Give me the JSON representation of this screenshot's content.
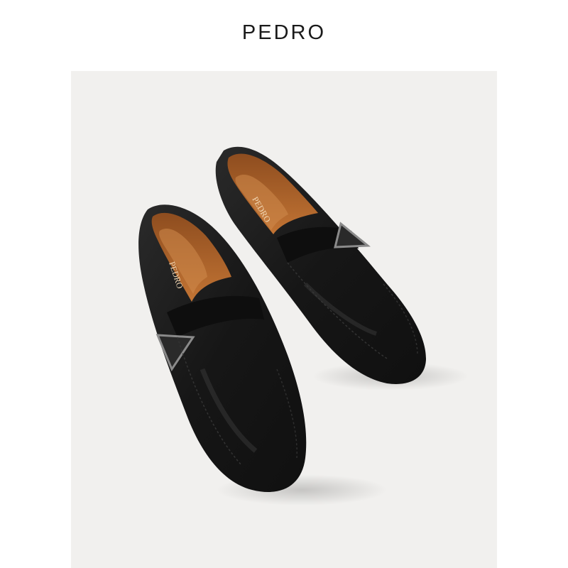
{
  "brand": {
    "name": "PEDRO"
  },
  "product_photo": {
    "insole_brand_text": "PEDRO",
    "colors": {
      "backdrop": "#f1f0ee",
      "leather": "#1c1c1c",
      "lining": "#b8692e",
      "hardware": "#7d7d7d"
    }
  }
}
